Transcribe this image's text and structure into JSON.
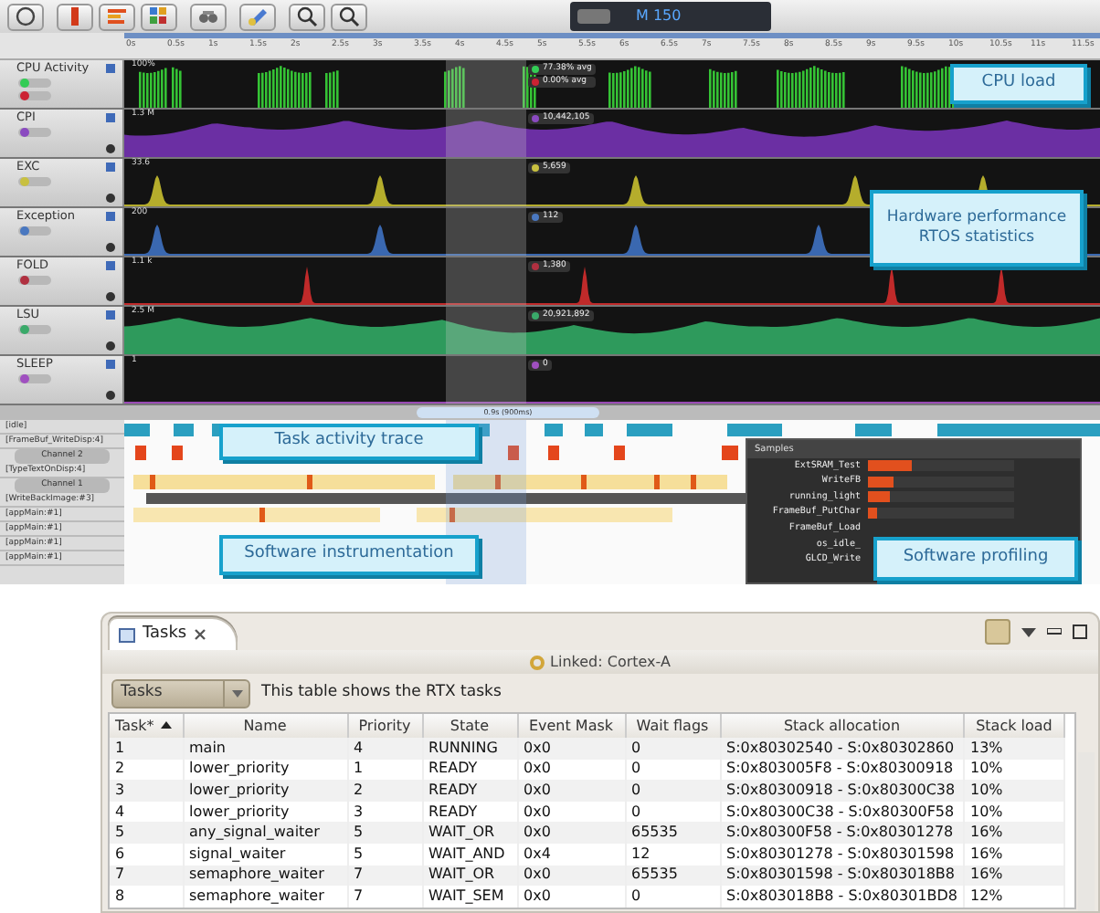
{
  "display": {
    "value": "M 150"
  },
  "ruler": {
    "ticks": [
      "0s",
      "0.5s",
      "1s",
      "1.5s",
      "2s",
      "2.5s",
      "3s",
      "3.5s",
      "4s",
      "4.5s",
      "5s",
      "5.5s",
      "6s",
      "6.5s",
      "7s",
      "7.5s",
      "8s",
      "8.5s",
      "9s",
      "9.5s",
      "10s",
      "10.5s",
      "11s",
      "11.5s"
    ]
  },
  "tracks": [
    {
      "name": "CPU Activity",
      "kind": "bars",
      "color": "#35c335",
      "scale": "100%",
      "readouts": [
        "77.38% avg",
        "0.00% avg"
      ],
      "legend": [
        {
          "color": "#33cc55"
        },
        {
          "color": "#cc2233"
        }
      ]
    },
    {
      "name": "CPI",
      "kind": "area",
      "color": "#6b2fa3",
      "scale": "1.3 M",
      "readouts": [
        "10,442,105"
      ],
      "legend": [
        {
          "color": "#8a4ac0"
        }
      ]
    },
    {
      "name": "EXC",
      "kind": "spikes",
      "color": "#b5ad2c",
      "scale": "33.6",
      "readouts": [
        "5,659"
      ],
      "legend": [
        {
          "color": "#c8c040"
        }
      ]
    },
    {
      "name": "Exception",
      "kind": "spikes",
      "color": "#3a68b0",
      "scale": "200",
      "readouts": [
        "112"
      ],
      "legend": [
        {
          "color": "#4a78c0"
        }
      ]
    },
    {
      "name": "FOLD",
      "kind": "spikes",
      "color": "#c02a2a",
      "scale": "1.1 k",
      "readouts": [
        "1,380"
      ],
      "legend": [
        {
          "color": "#b03040"
        }
      ]
    },
    {
      "name": "LSU",
      "kind": "area",
      "color": "#2e9a5c",
      "scale": "2.5 M",
      "readouts": [
        "20,921,892"
      ],
      "legend": [
        {
          "color": "#3aaa6a"
        }
      ]
    },
    {
      "name": "SLEEP",
      "kind": "flat",
      "color": "#9a4ab5",
      "scale": "1",
      "readouts": [
        "0"
      ],
      "legend": [
        {
          "color": "#a050c0"
        }
      ]
    }
  ],
  "scrollbar": {
    "label": "0.9s (900ms)"
  },
  "trace": {
    "rows": [
      {
        "label": "[idle]"
      },
      {
        "label": "[FrameBuf_WriteDisp:4]",
        "channel": "Channel 2"
      },
      {
        "label": "[TypeTextOnDisp:4]",
        "channel": "Channel 1"
      },
      {
        "label": "[WriteBackImage:#3]"
      },
      {
        "label": "[appMain:#1]"
      },
      {
        "label": "[appMain:#1]"
      },
      {
        "label": "[appMain:#1]"
      },
      {
        "label": "[appMain:#1]"
      }
    ]
  },
  "samples": {
    "title": "Samples",
    "rows": [
      {
        "name": "ExtSRAM_Test",
        "level": 0.3
      },
      {
        "name": "WriteFB",
        "level": 0.17
      },
      {
        "name": "running_light",
        "level": 0.15
      },
      {
        "name": "FrameBuf_PutChar",
        "level": 0.06
      },
      {
        "name": "FrameBuf_Load"
      },
      {
        "name": "os_idle_"
      },
      {
        "name": "GLCD_Write"
      }
    ]
  },
  "callouts": [
    "CPU load",
    "Hardware performance RTOS statistics",
    "Task activity trace",
    "Software instrumentation",
    "Software profiling"
  ],
  "tasks_view": {
    "tab": {
      "label": "Tasks",
      "selected": true
    },
    "linked": "Linked: Cortex-A",
    "filter": "Tasks",
    "description": "This table shows the RTX tasks",
    "columns": [
      "Task*",
      "Name",
      "Priority",
      "State",
      "Event Mask",
      "Wait flags",
      "Stack allocation",
      "Stack load"
    ],
    "rows": [
      [
        "1",
        "main",
        "4",
        "RUNNING",
        "0x0",
        "0",
        "S:0x80302540 - S:0x80302860",
        "13%"
      ],
      [
        "2",
        "lower_priority",
        "1",
        "READY",
        "0x0",
        "0",
        "S:0x803005F8 - S:0x80300918",
        "10%"
      ],
      [
        "3",
        "lower_priority",
        "2",
        "READY",
        "0x0",
        "0",
        "S:0x80300918 - S:0x80300C38",
        "10%"
      ],
      [
        "4",
        "lower_priority",
        "3",
        "READY",
        "0x0",
        "0",
        "S:0x80300C38 - S:0x80300F58",
        "10%"
      ],
      [
        "5",
        "any_signal_waiter",
        "5",
        "WAIT_OR",
        "0x0",
        "65535",
        "S:0x80300F58 - S:0x80301278",
        "16%"
      ],
      [
        "6",
        "signal_waiter",
        "5",
        "WAIT_AND",
        "0x4",
        "12",
        "S:0x80301278 - S:0x80301598",
        "16%"
      ],
      [
        "7",
        "semaphore_waiter",
        "7",
        "WAIT_OR",
        "0x0",
        "65535",
        "S:0x80301598 - S:0x803018B8",
        "16%"
      ],
      [
        "8",
        "semaphore_waiter",
        "7",
        "WAIT_SEM",
        "0x0",
        "0",
        "S:0x803018B8 - S:0x80301BD8",
        "12%"
      ]
    ]
  }
}
